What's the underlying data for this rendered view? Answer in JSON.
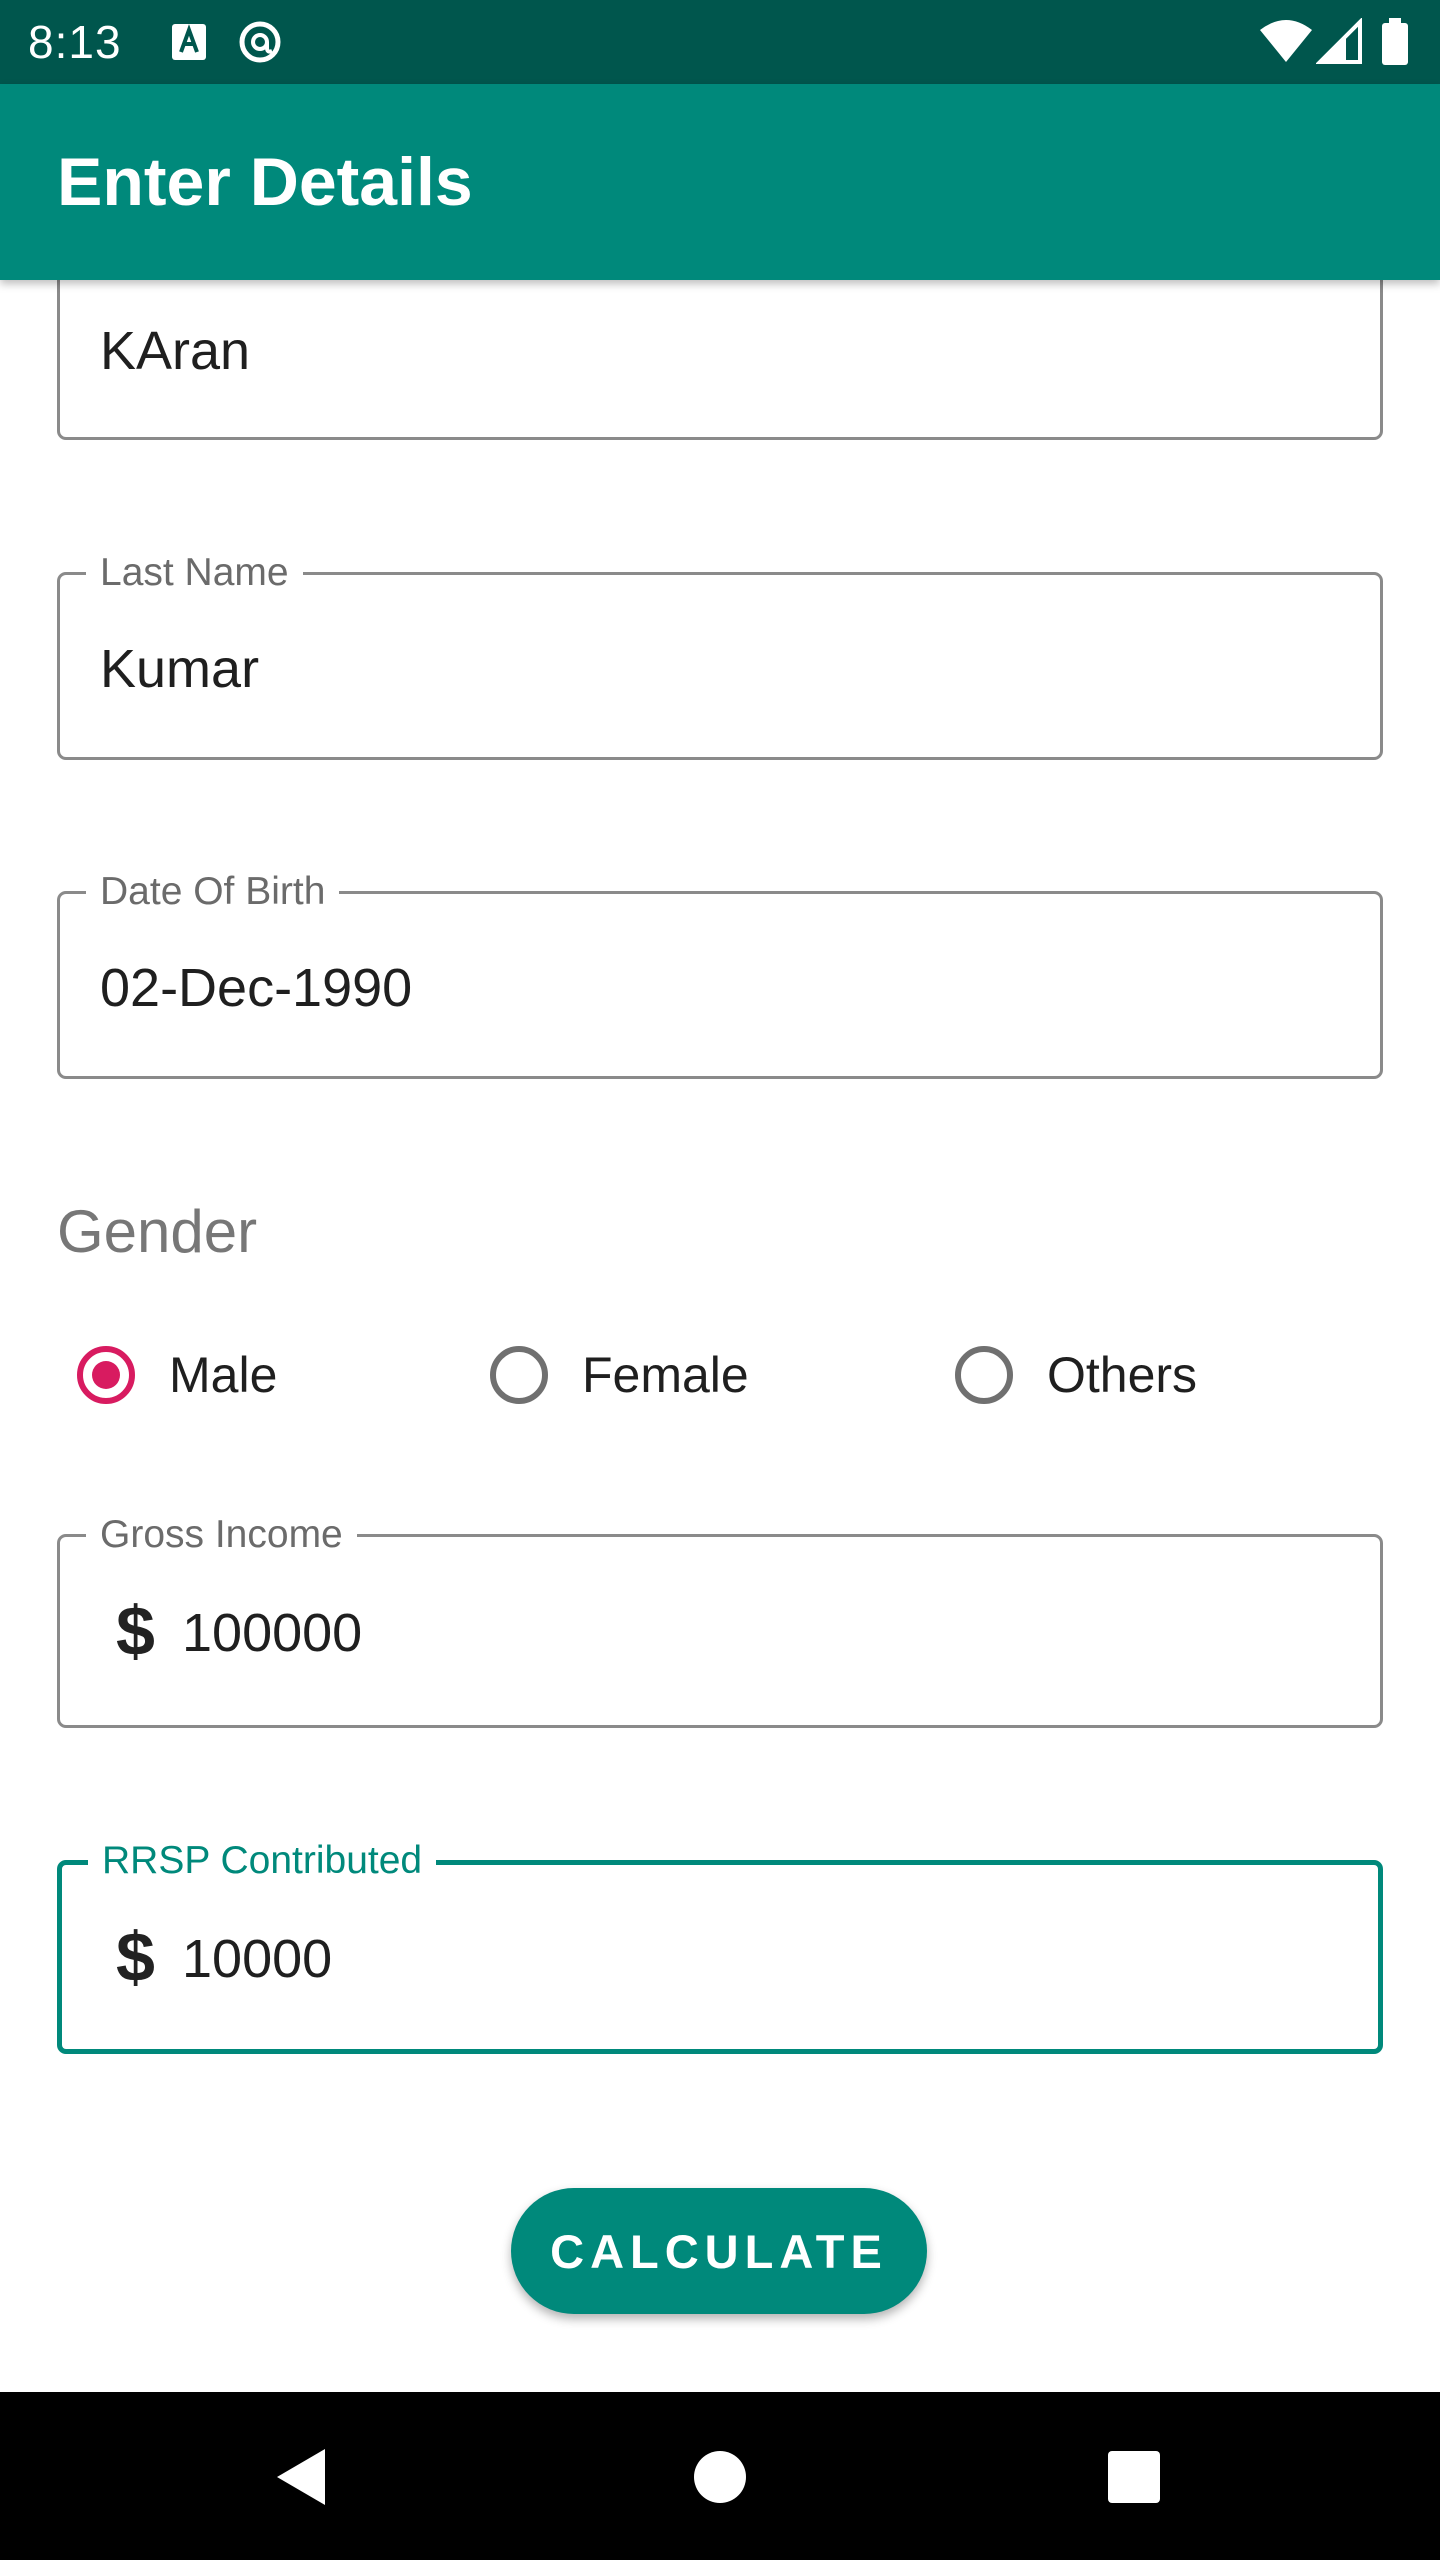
{
  "status_bar": {
    "time": "8:13",
    "icons": [
      "keyboard-a-icon",
      "at-sign-icon",
      "wifi-icon",
      "signal-icon",
      "battery-icon"
    ]
  },
  "app_bar": {
    "title": "Enter Details"
  },
  "form": {
    "first_name": {
      "value": "KAran"
    },
    "last_name": {
      "label": "Last Name",
      "value": "Kumar"
    },
    "dob": {
      "label": "Date Of Birth",
      "value": "02-Dec-1990"
    },
    "gender": {
      "title": "Gender",
      "options": [
        {
          "label": "Male",
          "checked": true
        },
        {
          "label": "Female",
          "checked": false
        },
        {
          "label": "Others",
          "checked": false
        }
      ]
    },
    "gross_income": {
      "label": "Gross Income",
      "prefix": "$",
      "value": "100000"
    },
    "rrsp": {
      "label": "RRSP Contributed",
      "prefix": "$",
      "value": "10000"
    }
  },
  "button": {
    "label": "CALCULATE"
  },
  "colors": {
    "status_bar": "#00564d",
    "app_bar": "#00897b",
    "accent": "#d81b60",
    "focused_outline": "#00897b"
  },
  "nav_bar": {
    "icons": [
      "back-icon",
      "home-icon",
      "recents-icon"
    ]
  }
}
